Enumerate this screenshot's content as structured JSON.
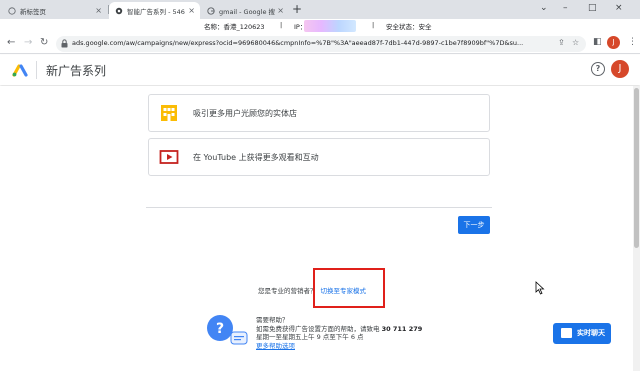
{
  "browser": {
    "tabs": [
      {
        "title": "新标签页",
        "active": false
      },
      {
        "title": "智能广告系列 - 546",
        "active": true
      },
      {
        "title": "gmail - Google 搜",
        "active": false
      }
    ],
    "new_tab_symbol": "+",
    "info_bar": {
      "name": "名称：香港_120623",
      "ip_label": "IP：",
      "sep": "|",
      "security": "安全状态：安全"
    },
    "url": "ads.google.com/aw/campaigns/new/express?ocid=969680046&cmpnInfo=%7B\"%3A\"aeead87f-7db1-447d-9897-c1be7f8909bf\"%7D&su...",
    "profile_initial": "J"
  },
  "app": {
    "title": "新广告系列",
    "help_symbol": "?",
    "avatar_initial": "J"
  },
  "goals": [
    {
      "label": "吸引更多用户光顾您的实体店",
      "icon": "storefront-icon"
    },
    {
      "label": "在 YouTube 上获得更多观看和互动",
      "icon": "youtube-play-icon"
    }
  ],
  "next_button": "下一步",
  "pro": {
    "prompt": "您是专业的营销者？",
    "link": "切换至专家模式"
  },
  "help": {
    "title": "需要帮助？",
    "line1": "如需免费获得广告设置方面的帮助，请致电",
    "phone": "30 711 279",
    "line2": "星期一至星期五上午 9 点至下午 6 点",
    "more": "更多帮助选项"
  },
  "chat_button": "实时聊天",
  "colors": {
    "accent": "#1a73e8",
    "avatar": "#d6482a",
    "highlight": "#e0201a"
  }
}
